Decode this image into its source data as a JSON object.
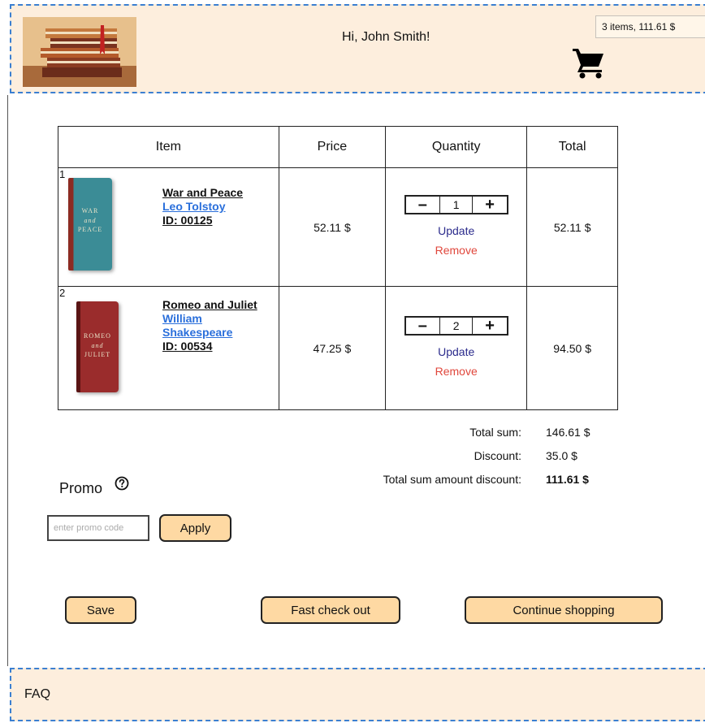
{
  "header": {
    "greeting": "Hi, John Smith!",
    "cart_summary": "3 items, 111.61 $",
    "cart_icon": "shopping-cart-icon",
    "banner_icon": "stacked-books-image"
  },
  "table": {
    "headers": [
      "Item",
      "Price",
      "Quantity",
      "Total"
    ],
    "rows": [
      {
        "num": "1",
        "title": "War and Peace",
        "author": "Leo Tolstoy",
        "id": "ID: 00125",
        "cover_text_1": "WAR",
        "cover_text_2": "and",
        "cover_text_3": "PEACE",
        "price": "52.11 $",
        "qty": "1",
        "minus": "–",
        "plus": "+",
        "update": "Update",
        "remove": "Remove",
        "total": "52.11 $"
      },
      {
        "num": "2",
        "title": "Romeo and Juliet",
        "author": "William Shakespeare",
        "id": "ID: 00534",
        "cover_text_1": "ROMEO",
        "cover_text_2": "and",
        "cover_text_3": "JULIET",
        "price": "47.25 $",
        "qty": "2",
        "minus": "–",
        "plus": "+",
        "update": "Update",
        "remove": "Remove",
        "total": "94.50 $"
      }
    ]
  },
  "totals": {
    "sum_label": "Total sum:",
    "sum_value": "146.61 $",
    "discount_label": "Discount:",
    "discount_value": "35.0 $",
    "final_label": "Total sum amount discount:",
    "final_value": "111.61 $"
  },
  "promo": {
    "label": "Promo",
    "help_icon": "question-circle-icon",
    "placeholder": "enter promo code",
    "apply_label": "Apply"
  },
  "actions": {
    "save": "Save",
    "fast_checkout": "Fast check out",
    "continue": "Continue shopping"
  },
  "footer": {
    "faq": "FAQ"
  },
  "colors": {
    "header_bg": "#fdeedd",
    "dashed_border": "#3b7fd1",
    "button_bg": "#fed9a3",
    "link_blue": "#2a6fdb",
    "remove_red": "#e0473c"
  }
}
